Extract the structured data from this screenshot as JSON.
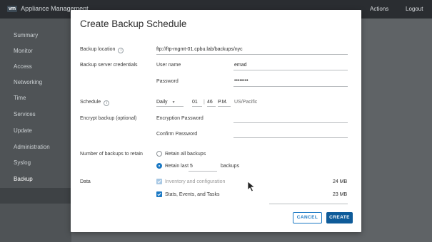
{
  "app": {
    "logo": "vm",
    "title": "Appliance Management",
    "top_actions": "Actions",
    "top_logout": "Logout"
  },
  "sidebar": {
    "items": [
      "Summary",
      "Monitor",
      "Access",
      "Networking",
      "Time",
      "Services",
      "Update",
      "Administration",
      "Syslog",
      "Backup"
    ],
    "active": "Backup"
  },
  "modal": {
    "title": "Create Backup Schedule",
    "backup_location_label": "Backup location",
    "backup_location_value": "ftp://ftp-mgmt-01.cpbu.lab/backups/nyc",
    "credentials_label": "Backup server credentials",
    "username_label": "User name",
    "username_value": "emad",
    "password_label": "Password",
    "password_value": "••••••••",
    "schedule_label": "Schedule",
    "schedule_frequency": "Daily",
    "schedule_hour": "01",
    "schedule_minute": "46",
    "schedule_ampm": "P.M.",
    "schedule_timezone": "US/Pacific",
    "encrypt_label": "Encrypt backup (optional)",
    "encryption_password_label": "Encryption Password",
    "confirm_password_label": "Confirm Password",
    "retain_label": "Number of backups to retain",
    "retain_all_label": "Retain all backups",
    "retain_last_label": "Retain last",
    "retain_last_value": "5",
    "retain_last_suffix": "backups",
    "data_label": "Data",
    "data_items": [
      {
        "label": "Inventory and configuration",
        "size": "24 MB",
        "checked": true,
        "disabled": true
      },
      {
        "label": "Stats, Events, and Tasks",
        "size": "23 MB",
        "checked": true,
        "disabled": false
      }
    ],
    "cancel_label": "CANCEL",
    "create_label": "CREATE"
  },
  "colors": {
    "accent": "#1b79c4",
    "primary_button": "#0e5b99",
    "topbar": "#2a2d31"
  }
}
